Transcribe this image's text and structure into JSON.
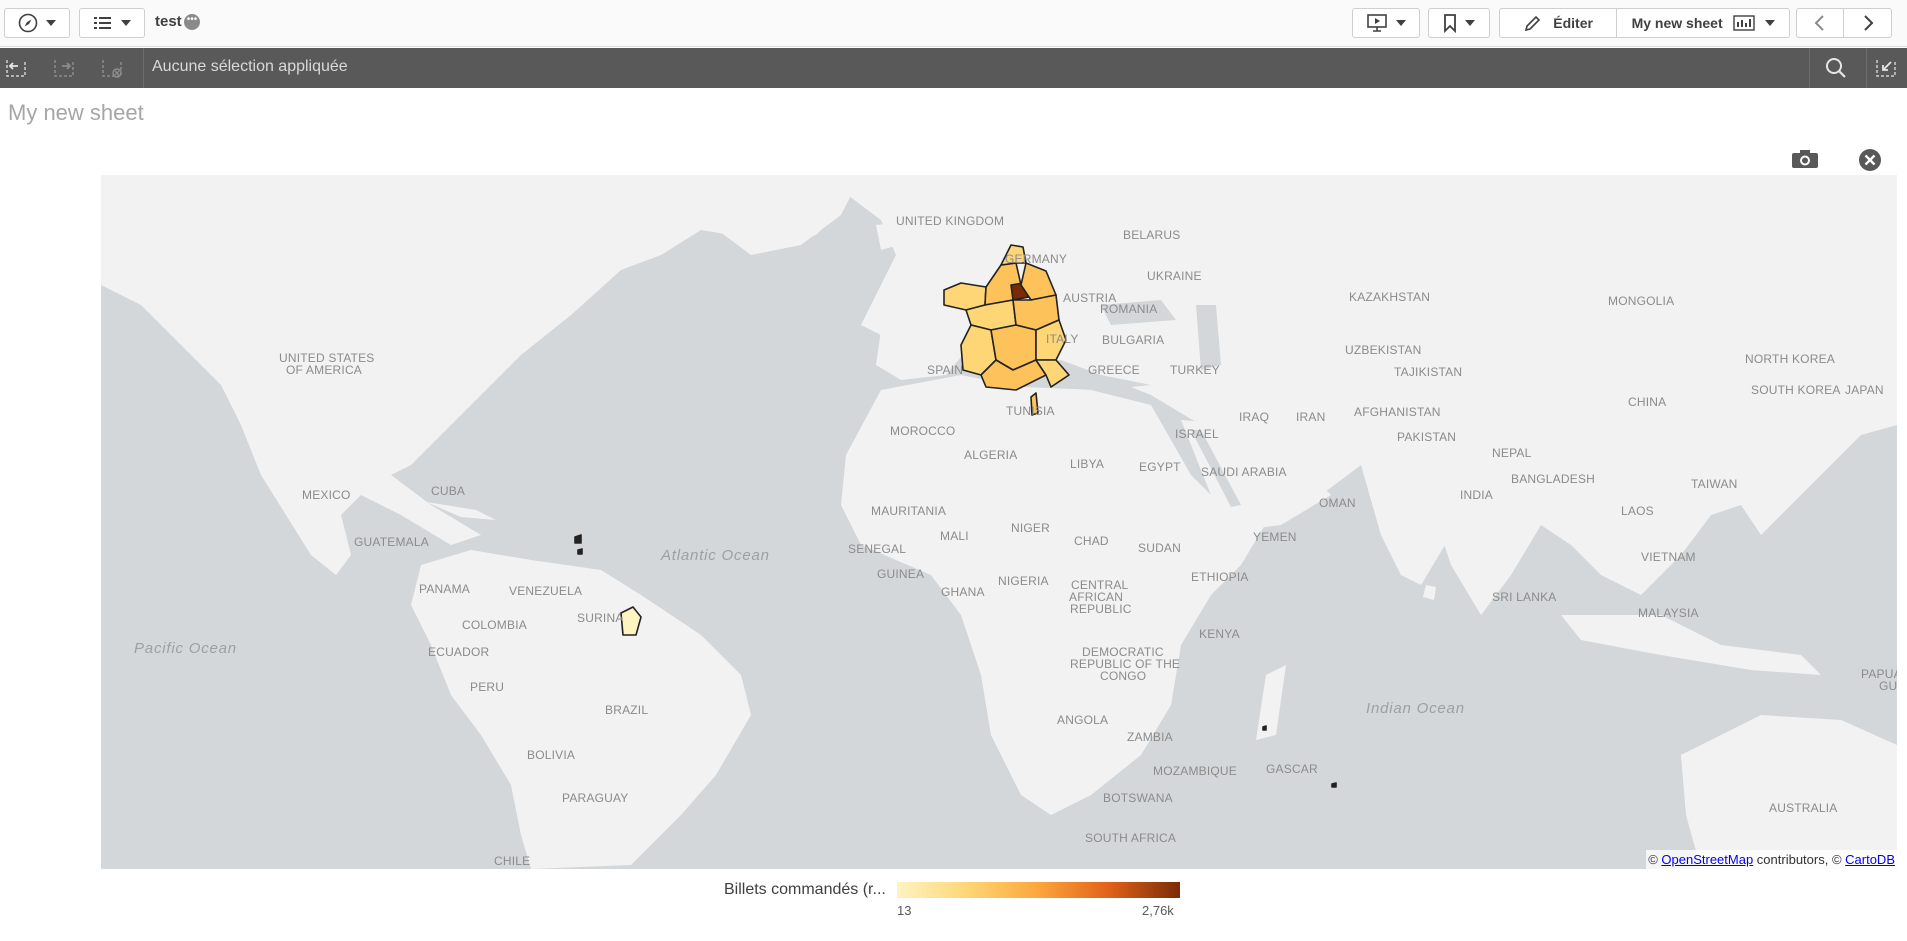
{
  "toolbar": {
    "app_title": "test",
    "app_badge": "•••",
    "edit_label": "Éditer",
    "sheet_selector_label": "My new sheet"
  },
  "selection_bar": {
    "status": "Aucune sélection appliquée"
  },
  "sheet": {
    "title": "My new sheet"
  },
  "map": {
    "country_labels": [
      "UNITED KINGDOM",
      "BELARUS",
      "GERMANY",
      "UKRAINE",
      "KAZAKHSTAN",
      "MONGOLIA",
      "AUSTRIA",
      "ROMANIA",
      "BULGARIA",
      "ITALY",
      "UZBEKISTAN",
      "TAJIKISTAN",
      "SPAIN",
      "GREECE",
      "TURKEY",
      "NORTH KOREA",
      "SOUTH KOREA",
      "JAPAN",
      "CHINA",
      "UNITED STATES",
      "OF AMERICA",
      "TUNISIA",
      "AFGHANISTAN",
      "IRAQ",
      "IRAN",
      "MOROCCO",
      "ISRAEL",
      "PAKISTAN",
      "ALGERIA",
      "LIBYA",
      "EGYPT",
      "SAUDI ARABIA",
      "NEPAL",
      "BANGLADESH",
      "MEXICO",
      "CUBA",
      "INDIA",
      "OMAN",
      "TAIWAN",
      "MAURITANIA",
      "LAOS",
      "GUATEMALA",
      "MALI",
      "NIGER",
      "CHAD",
      "SUDAN",
      "YEMEN",
      "SENEGAL",
      "VIETNAM",
      "GUINEA",
      "NIGERIA",
      "ETHIOPIA",
      "PANAMA",
      "VENEZUELA",
      "GHANA",
      "CENTRAL",
      "AFRICAN",
      "REPUBLIC",
      "SRI LANKA",
      "COLOMBIA",
      "SURINA",
      "MALAYSIA",
      "KENYA",
      "ECUADOR",
      "DEMOCRATIC",
      "REPUBLIC OF THE",
      "CONGO",
      "PERU",
      "PAPUA",
      "GUI",
      "BRAZIL",
      "ANGOLA",
      "ZAMBIA",
      "BOLIVIA",
      "MOZAMBIQUE",
      "GASCAR",
      "PARAGUAY",
      "BOTSWANA",
      "AUSTRALIA",
      "SOUTH AFRICA",
      "CHILE"
    ],
    "ocean_labels": [
      "Atlantic Ocean",
      "Pacific Ocean",
      "Indian Ocean"
    ],
    "attribution": {
      "prefix": "© ",
      "osm_link": "OpenStreetMap",
      "middle": " contributors, © ",
      "carto_link": "CartoDB"
    },
    "colors": {
      "water": "#d4d7d9",
      "land": "#f2f2f2",
      "region_light": "#fed676",
      "region_mid": "#fdc35a",
      "region_dark": "#7a2a06"
    }
  },
  "legend": {
    "title": "Billets commandés (r...",
    "min_label": "13",
    "max_label": "2,76k"
  }
}
